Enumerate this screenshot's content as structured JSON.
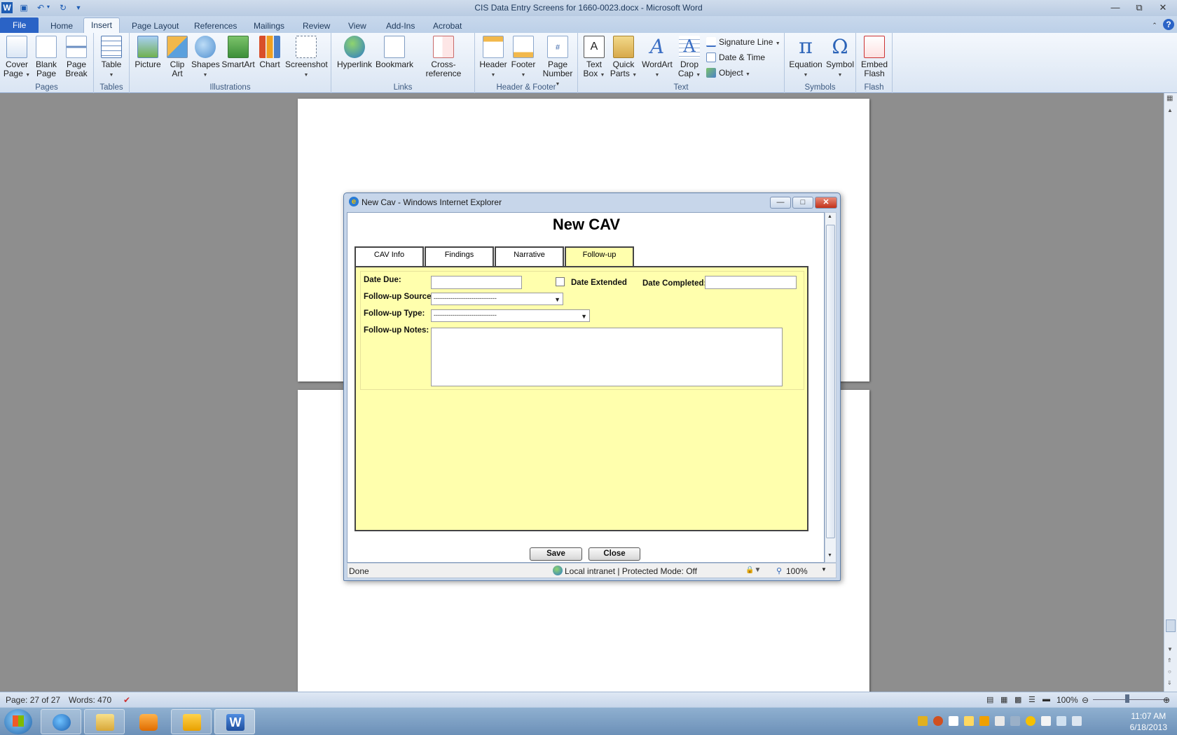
{
  "window": {
    "title": "CIS Data Entry Screens for 1660-0023.docx - Microsoft Word",
    "word_icon": "W"
  },
  "ribbon": {
    "tabs": [
      "File",
      "Home",
      "Insert",
      "Page Layout",
      "References",
      "Mailings",
      "Review",
      "View",
      "Add-Ins",
      "Acrobat"
    ],
    "active_tab": "Insert",
    "groups": {
      "pages": {
        "label": "Pages",
        "buttons": [
          {
            "l1": "Cover",
            "l2": "Page"
          },
          {
            "l1": "Blank",
            "l2": "Page"
          },
          {
            "l1": "Page",
            "l2": "Break"
          }
        ]
      },
      "tables": {
        "label": "Tables",
        "buttons": [
          {
            "l1": "Table",
            "l2": ""
          }
        ]
      },
      "illustrations": {
        "label": "Illustrations",
        "buttons": [
          {
            "l1": "Picture",
            "l2": ""
          },
          {
            "l1": "Clip",
            "l2": "Art"
          },
          {
            "l1": "Shapes",
            "l2": ""
          },
          {
            "l1": "SmartArt",
            "l2": ""
          },
          {
            "l1": "Chart",
            "l2": ""
          },
          {
            "l1": "Screenshot",
            "l2": ""
          }
        ]
      },
      "links": {
        "label": "Links",
        "buttons": [
          {
            "l1": "Hyperlink",
            "l2": ""
          },
          {
            "l1": "Bookmark",
            "l2": ""
          },
          {
            "l1": "Cross-reference",
            "l2": ""
          }
        ]
      },
      "header_footer": {
        "label": "Header & Footer",
        "buttons": [
          {
            "l1": "Header",
            "l2": ""
          },
          {
            "l1": "Footer",
            "l2": ""
          },
          {
            "l1": "Page",
            "l2": "Number"
          }
        ]
      },
      "text": {
        "label": "Text",
        "buttons": [
          {
            "l1": "Text",
            "l2": "Box"
          },
          {
            "l1": "Quick",
            "l2": "Parts"
          },
          {
            "l1": "WordArt",
            "l2": ""
          },
          {
            "l1": "Drop",
            "l2": "Cap"
          }
        ],
        "small": [
          "Signature Line",
          "Date & Time",
          "Object"
        ]
      },
      "symbols": {
        "label": "Symbols",
        "buttons": [
          {
            "l1": "Equation",
            "l2": ""
          },
          {
            "l1": "Symbol",
            "l2": ""
          }
        ]
      },
      "flash": {
        "label": "Flash",
        "buttons": [
          {
            "l1": "Embed",
            "l2": "Flash"
          }
        ]
      }
    }
  },
  "ie": {
    "title": "New Cav - Windows Internet Explorer",
    "status_left": "Done",
    "zone": "Local intranet | Protected Mode: Off",
    "zoom": "100%"
  },
  "form": {
    "title": "New CAV",
    "tabs": [
      "CAV Info",
      "Findings",
      "Narrative",
      "Follow-up"
    ],
    "active_tab": "Follow-up",
    "date_due_label": "Date Due:",
    "date_due_value": "",
    "date_extended_label": "Date Extended",
    "date_extended_checked": false,
    "date_completed_label": "Date Completed:",
    "date_completed_value": "",
    "source_label": "Follow-up Source:",
    "source_value": "------------------------------",
    "type_label": "Follow-up Type:",
    "type_value": "------------------------------",
    "notes_label": "Follow-up Notes:",
    "notes_value": "",
    "save_label": "Save",
    "close_label": "Close"
  },
  "status": {
    "page": "Page: 27 of 27",
    "words": "Words: 470",
    "zoom": "100%"
  },
  "taskbar": {
    "time": "11:07 AM",
    "date": "6/18/2013"
  },
  "colors": {
    "form_bg": "#ffffad",
    "file_tab": "#2a63c6",
    "doc_bg": "#8e8e8e"
  }
}
